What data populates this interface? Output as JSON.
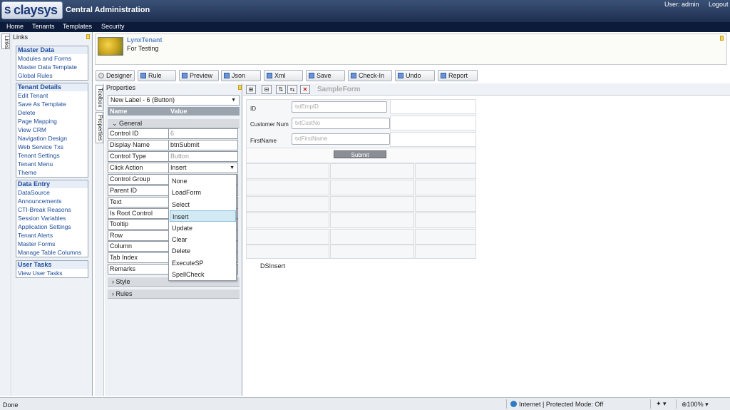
{
  "header": {
    "logo_text": "claysys",
    "app_title": "Central Administration",
    "user_label": "User: admin",
    "logout_label": "Logout"
  },
  "nav": [
    "Home",
    "Tenants",
    "Templates",
    "Security"
  ],
  "left_tab": "Links",
  "links": {
    "title": "Links",
    "groups": [
      {
        "title": "Master Data",
        "items": [
          "Modules and Forms",
          "Master Data Template",
          "Global Rules"
        ]
      },
      {
        "title": "Tenant Details",
        "items": [
          "Edit Tenant",
          "Save As Template",
          "Delete",
          "Page Mapping",
          "View CRM",
          "Navigation Design",
          "Web Service Txs",
          "Tenant Settings",
          "Tenant Menu",
          "Theme"
        ]
      },
      {
        "title": "Data Entry",
        "items": [
          "DataSource",
          "Announcements",
          "CTI-Break Reasons",
          "Session Variables",
          "Application Settings",
          "Tenant Alerts",
          "Master Forms",
          "Manage Table Columns"
        ]
      },
      {
        "title": "User Tasks",
        "items": [
          "View User Tasks"
        ]
      }
    ]
  },
  "tenant": {
    "name": "LynxTenant",
    "description": "For Testing"
  },
  "toolbar": [
    "Designer",
    "Rule",
    "Preview",
    "Json",
    "Xml",
    "Save",
    "Check-In",
    "Undo",
    "Report"
  ],
  "side_tabs": [
    "Toolbox",
    "Properties"
  ],
  "properties": {
    "title": "Properties",
    "selected_control": "New Label - 6 (Button)",
    "col_name": "Name",
    "col_value": "Value",
    "section_general": "General",
    "rows": [
      {
        "name": "Control ID",
        "value": "6"
      },
      {
        "name": "Display Name",
        "value": "btnSubmit"
      },
      {
        "name": "Control Type",
        "value": "Button"
      },
      {
        "name": "Click Action",
        "value": "Insert"
      },
      {
        "name": "Control Group",
        "value": ""
      },
      {
        "name": "Parent ID",
        "value": ""
      },
      {
        "name": "Text",
        "value": ""
      },
      {
        "name": "Is Root Control",
        "value": ""
      },
      {
        "name": "Tooltip",
        "value": ""
      },
      {
        "name": "Row",
        "value": ""
      },
      {
        "name": "Column",
        "value": ""
      },
      {
        "name": "Tab Index",
        "value": ""
      },
      {
        "name": "Remarks",
        "value": ""
      }
    ],
    "section_style": "Style",
    "section_rules": "Rules",
    "dropdown_options": [
      "None",
      "LoadForm",
      "Select",
      "Insert",
      "Update",
      "Clear",
      "Delete",
      "ExecuteSP",
      "SpellCheck"
    ],
    "dropdown_selected": "Insert"
  },
  "designer": {
    "form_name": "SampleForm",
    "fields": [
      {
        "label": "ID",
        "placeholder": "txtEmpID"
      },
      {
        "label": "Customer Num",
        "placeholder": "txtCustNo"
      },
      {
        "label": "FirstName",
        "placeholder": "txtFirstName"
      }
    ],
    "submit_label": "Submit",
    "footer_label": "DSInsert"
  },
  "status": {
    "left": "Done",
    "zone": "Internet | Protected Mode: Off",
    "zoom": "100%"
  }
}
